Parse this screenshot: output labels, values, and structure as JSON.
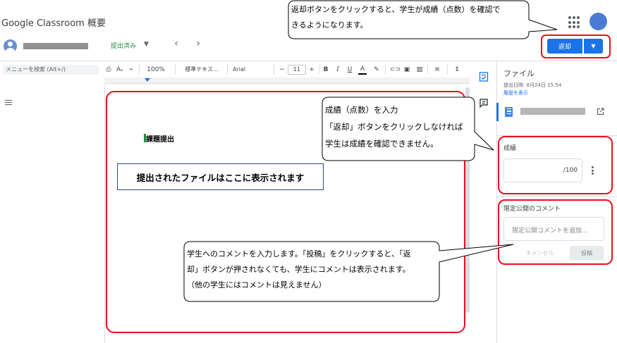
{
  "header": {
    "app_title": "Google Classroom 概要",
    "status_label": "提出済み",
    "status_dropdown_glyph": "▼",
    "prev_glyph": "‹",
    "next_glyph": "›",
    "return_label": "返却",
    "return_menu_glyph": "▼"
  },
  "toolbar": {
    "menu_search": "メニューを検索 (Alt+/)",
    "zoom": "100%",
    "style": "標準テキス...",
    "font": "Arial",
    "font_size": "11",
    "minus": "−",
    "plus": "+",
    "bold": "B",
    "italic": "I",
    "underline": "U",
    "text_color": "A"
  },
  "document": {
    "heading": "課題提出",
    "file_placeholder": "提出されたファイルはここに表示されます"
  },
  "panel": {
    "files_title": "ファイル",
    "submitted_date": "提出日時: 8月24日 15:54",
    "history_link": "履歴を表示",
    "grade_label": "成績",
    "grade_denominator": "/100",
    "private_comment_label": "限定公開のコメント",
    "private_comment_placeholder": "限定公開コメントを追加...",
    "cancel_label": "キャンセル",
    "post_label": "投稿"
  },
  "callouts": {
    "return": {
      "line1": "返却ボタンをクリックすると、学生が成績（点数）を確認で",
      "line2": "きるようになります。"
    },
    "grade": {
      "line1": "成績（点数）を入力",
      "line2": "「返却」ボタンをクリックしなければ",
      "line3": "学生は成績を確認できません。"
    },
    "comment": {
      "line1": "学生へのコメントを入力します。「投稿」をクリックすると、「返",
      "line2": "却」ボタンが押されなくても、学生にコメントは表示されます。",
      "line3": "（他の学生にはコメントは見えません）"
    }
  },
  "colors": {
    "accent": "#1a73e8",
    "annotation_red": "#e8101e",
    "submitted_green": "#1e8e3e"
  }
}
